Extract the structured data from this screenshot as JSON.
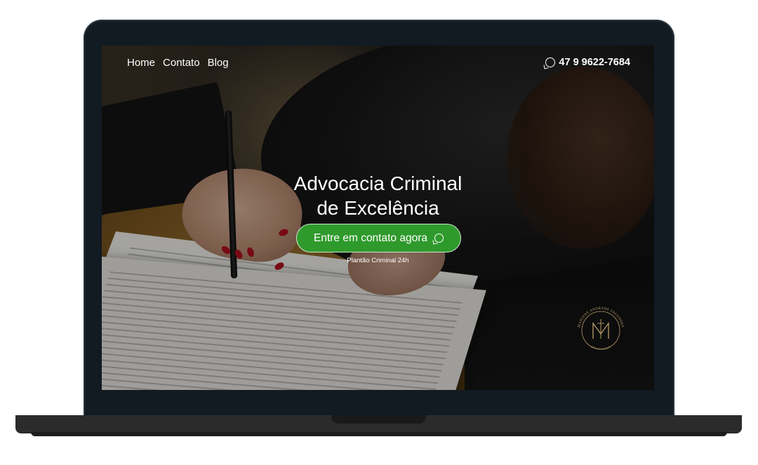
{
  "nav": {
    "items": [
      "Home",
      "Contato",
      "Blog"
    ]
  },
  "header": {
    "phone": "47 9 9622-7684",
    "phone_icon": "whatsapp-icon"
  },
  "hero": {
    "title_line1": "Advocacia Criminal",
    "title_line2": "de Excelência",
    "cta_label": "Entre em contato agora",
    "cta_icon": "whatsapp-icon",
    "cta_color": "#2f9a2c",
    "subtitle": "Plantão Criminal 24h"
  },
  "logo": {
    "top_text": "MARIANE ANDRADE FAGUNDES",
    "bottom_text": "ADVOGADA",
    "monogram": "M",
    "color": "#b89a68"
  }
}
